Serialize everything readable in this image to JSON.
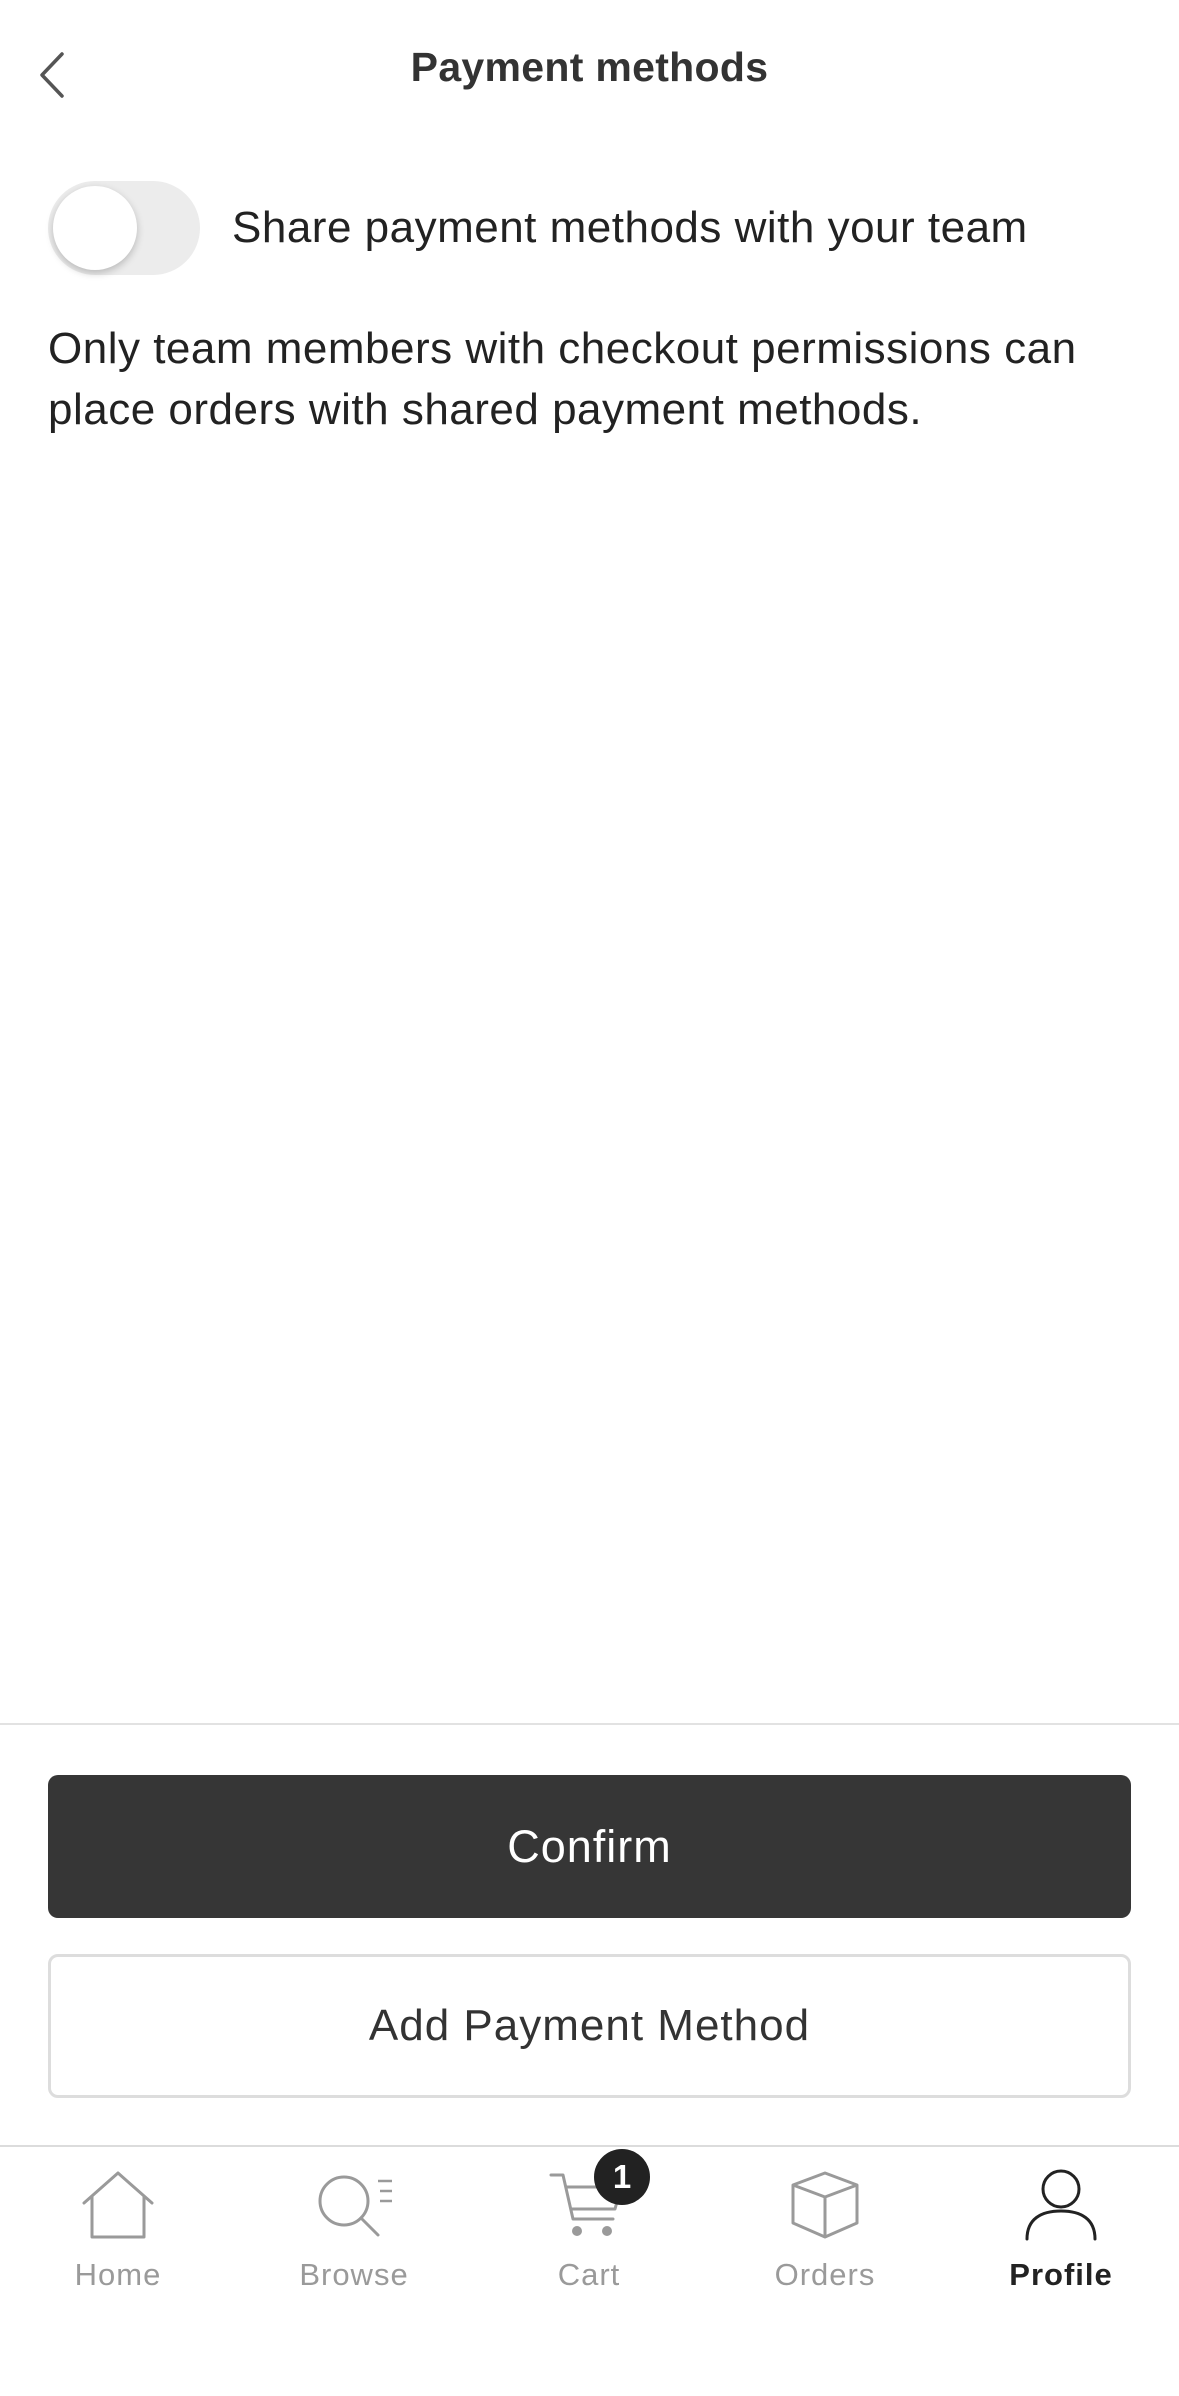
{
  "header": {
    "title": "Payment methods",
    "back_icon": "chevron-left-icon"
  },
  "share_toggle": {
    "label": "Share payment methods with your team",
    "enabled": false
  },
  "description": "Only team members with checkout permissions can place orders with shared payment methods.",
  "actions": {
    "confirm_label": "Confirm",
    "add_payment_label": "Add Payment Method"
  },
  "tabbar": {
    "tabs": [
      {
        "label": "Home",
        "icon": "home-icon",
        "active": false
      },
      {
        "label": "Browse",
        "icon": "browse-icon",
        "active": false
      },
      {
        "label": "Cart",
        "icon": "cart-icon",
        "active": false
      },
      {
        "label": "Orders",
        "icon": "orders-icon",
        "active": false
      },
      {
        "label": "Profile",
        "icon": "profile-icon",
        "active": true
      }
    ],
    "cart_badge_count": "1"
  },
  "colors": {
    "primary_button": "#363636",
    "inactive_tab": "#9a9a9a",
    "active_tab": "#222222"
  }
}
